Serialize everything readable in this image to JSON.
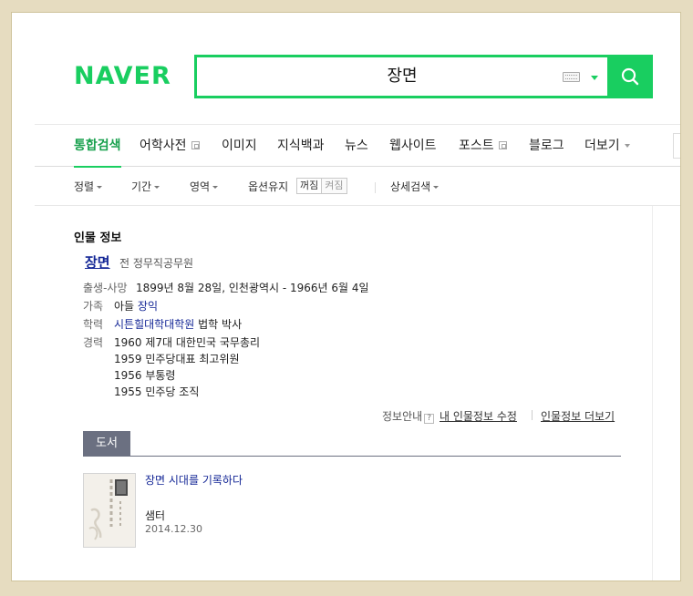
{
  "logo": "NAVER",
  "search": {
    "query": "장면"
  },
  "tabs": [
    {
      "label": "통합검색",
      "active": true
    },
    {
      "label": "어학사전",
      "ext": true
    },
    {
      "label": "이미지"
    },
    {
      "label": "지식백과"
    },
    {
      "label": "뉴스"
    },
    {
      "label": "웹사이트"
    },
    {
      "label": "포스트",
      "ext": true
    },
    {
      "label": "블로그"
    },
    {
      "label": "더보기",
      "caret": true
    }
  ],
  "options": {
    "sort": "정렬",
    "period": "기간",
    "area": "영역",
    "keep_label": "옵션유지",
    "keep_off": "꺼짐",
    "keep_on": "켜짐",
    "detail": "상세검색"
  },
  "person": {
    "section_title": "인물 정보",
    "name": "장면",
    "desc": "전 정무직공무원",
    "birth_label": "출생-사망",
    "birth_value": "1899년 8월 28일, 인천광역시 - 1966년 6월 4일",
    "family_label": "가족",
    "family_value_pre": "아들 ",
    "family_link": "장익",
    "edu_label": "학력",
    "edu_link": "시튼힐대학대학원",
    "edu_value_post": " 법학 박사",
    "career_label": "경력",
    "career": [
      "1960 제7대 대한민국 국무총리",
      "1959 민주당대표 최고위원",
      "1956 부통령",
      "1955 민주당 조직"
    ],
    "info_notice": "정보안내",
    "edit_link": "내 인물정보 수정",
    "more_link": "인물정보 더보기"
  },
  "books": {
    "tab_label": "도서",
    "items": [
      {
        "title": "장면 시대를 기록하다",
        "publisher": "샘터",
        "date": "2014.12.30"
      }
    ]
  },
  "colors": {
    "brand": "#19ce60",
    "link": "#142796"
  }
}
